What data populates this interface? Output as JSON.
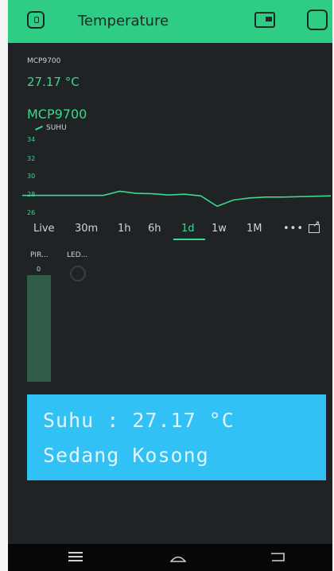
{
  "header": {
    "title": "Temperature"
  },
  "widget_value": {
    "label": "MCP9700",
    "value": "27.17 °C"
  },
  "chart_widget": {
    "title": "MCP9700",
    "legend": "SUHU",
    "y_ticks": [
      "34",
      "32",
      "30",
      "28",
      "26"
    ],
    "ranges": [
      "Live",
      "30m",
      "1h",
      "6h",
      "1d",
      "1w",
      "1M"
    ],
    "active_range": "1d",
    "more_label": "•••"
  },
  "chart_data": {
    "type": "line",
    "series": [
      {
        "name": "SUHU",
        "values": [
          27.9,
          27.9,
          27.9,
          27.9,
          27.9,
          27.9,
          28.4,
          28.15,
          28.1,
          27.95,
          28.05,
          27.85,
          26.6,
          27.35,
          27.6,
          27.7,
          27.7,
          27.75,
          27.8,
          27.85
        ]
      }
    ],
    "ylim": [
      25.5,
      35
    ],
    "grid": false,
    "legend_position": "top-left"
  },
  "pir": {
    "label": "PIR...",
    "value": "0",
    "level": 1.0
  },
  "led": {
    "label": "LED..."
  },
  "lcd": {
    "line1": "Suhu : 27.17 °C",
    "line2": "Sedang Kosong"
  },
  "colors": {
    "accent": "#2ecc84",
    "background": "#1f2326",
    "lcd": "#32c1f5",
    "lcd_text": "#dff6ff"
  },
  "nav": {
    "icons": [
      "menu-icon",
      "home-icon",
      "back-icon"
    ]
  }
}
